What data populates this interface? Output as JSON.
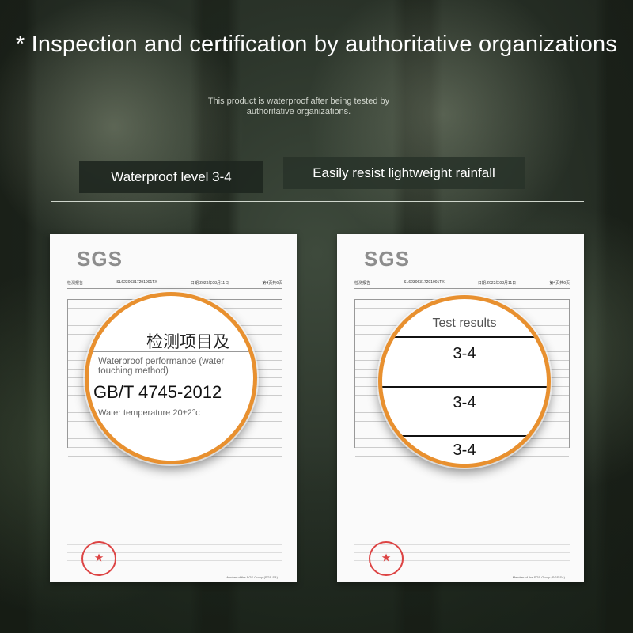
{
  "headline": "* Inspection and certification by authoritative organizations",
  "subtitle": "This product is waterproof after being tested by authoritative organizations.",
  "badges": {
    "left": "Waterproof level 3-4",
    "right": "Easily resist lightweight rainfall"
  },
  "documents": {
    "logo": "SGS",
    "report_label": "检测报告",
    "report_number": "SL62306317291901TX",
    "report_date": "日期:2023年08月11日",
    "page": "第4页共6页",
    "member_text": "Member of the SGS Group (SGS SA)"
  },
  "left_magnifier": {
    "chinese_header": "检测项目及",
    "performance_label": "Waterproof performance (water touching method)",
    "standard": "GB/T 4745-2012",
    "temperature": "Water temperature 20±2°c"
  },
  "right_magnifier": {
    "header": "Test results",
    "results": [
      "3-4",
      "3-4",
      "3-4"
    ]
  },
  "colors": {
    "loupe_ring": "#e8902f",
    "badge_bg": "#1e261f"
  }
}
